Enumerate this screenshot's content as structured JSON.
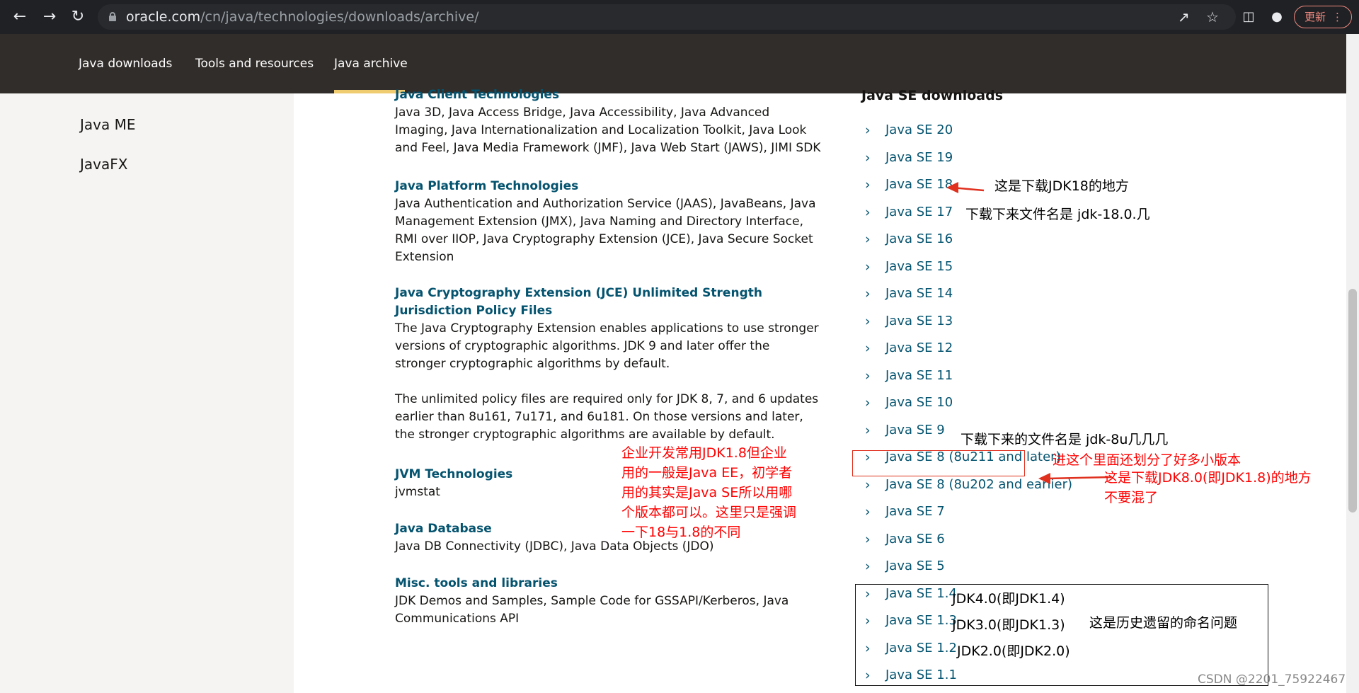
{
  "browser": {
    "url_host": "oracle.com",
    "url_path": "/cn/java/technologies/downloads/archive/",
    "update_label": "更新"
  },
  "site_nav": {
    "items": [
      "Java downloads",
      "Tools and resources",
      "Java archive"
    ],
    "active": "Java archive"
  },
  "sidebar": {
    "items": [
      "Java ME",
      "JavaFX"
    ]
  },
  "main": {
    "sections": [
      {
        "title": "Java Client Technologies",
        "body": "Java 3D, Java Access Bridge, Java Accessibility, Java Advanced Imaging, Java Internationalization and Localization Toolkit, Java Look and Feel, Java Media Framework (JMF), Java Web Start (JAWS), JIMI SDK"
      },
      {
        "title": "Java Platform Technologies",
        "body": "Java Authentication and Authorization Service (JAAS), JavaBeans, Java Management Extension (JMX), Java Naming and Directory Interface, RMI over IIOP, Java Cryptography Extension (JCE), Java Secure Socket Extension"
      },
      {
        "title": "Java Cryptography Extension (JCE) Unlimited Strength Jurisdiction Policy Files",
        "body": "The Java Cryptography Extension enables applications to use stronger versions of cryptographic algorithms. JDK 9 and later offer the stronger cryptographic algorithms by default.",
        "body2": "The unlimited policy files are required only for JDK 8, 7, and 6 updates earlier than 8u161, 7u171, and 6u181. On those versions and later, the stronger cryptographic algorithms are available by default."
      },
      {
        "title": "JVM Technologies",
        "body": "jvmstat"
      },
      {
        "title": "Java Database",
        "body": "Java DB Connectivity (JDBC), Java Data Objects (JDO)"
      },
      {
        "title": "Misc. tools and libraries",
        "body": "JDK Demos and Samples, Sample Code for GSSAPI/Kerberos, Java Communications API"
      }
    ]
  },
  "downloads": {
    "heading": "Java SE downloads",
    "items": [
      "Java SE 20",
      "Java SE 19",
      "Java SE 18",
      "Java SE 17",
      "Java SE 16",
      "Java SE 15",
      "Java SE 14",
      "Java SE 13",
      "Java SE 12",
      "Java SE 11",
      "Java SE 10",
      "Java SE 9",
      "Java SE 8 (8u211 and later)",
      "Java SE 8 (8u202 and earlier)",
      "Java SE 7",
      "Java SE 6",
      "Java SE 5",
      "Java SE 1.4",
      "Java SE 1.3",
      "Java SE 1.2",
      "Java SE 1.1"
    ]
  },
  "annotations": {
    "jdk18_here": "这是下载JDK18的地方",
    "jdk18_filename": "下载下来文件名是 jdk-18.0.几",
    "jdk8_filename": "下载下来的文件名是 jdk-8u几几几",
    "jdk8_versions": "进这个里面还划分了好多小版本",
    "jdk8_here_1": "这是下载JDK8.0(即JDK1.8)的地方",
    "jdk8_here_2": "不要混了",
    "enterprise_1": "企业开发常用JDK1.8但企业",
    "enterprise_2": "用的一般是Java EE，初学者",
    "enterprise_3": "用的其实是Java SE所以用哪",
    "enterprise_4": "个版本都可以。这里只是强调",
    "enterprise_5": "一下18与1.8的不同",
    "jdk4": "JDK4.0(即JDK1.4)",
    "jdk3": "JDK3.0(即JDK1.3)",
    "jdk2": "JDK2.0(即JDK2.0)",
    "naming": "这是历史遗留的命名问题"
  },
  "watermark": "CSDN @2201_75922467",
  "colors": {
    "link": "#04536f",
    "nav_bg": "#312d2a",
    "annotation_red": "#ff0000",
    "accent": "#f0cc71"
  }
}
